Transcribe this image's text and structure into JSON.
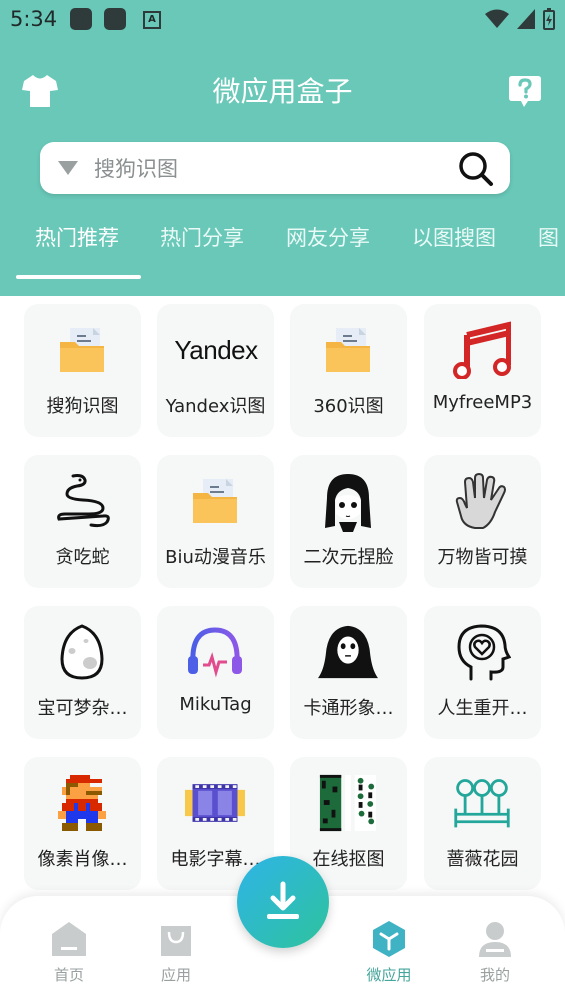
{
  "status_bar": {
    "time": "5:34",
    "a_icon": "A"
  },
  "header": {
    "title": "微应用盒子",
    "accent_color": "#69c8b8"
  },
  "search": {
    "placeholder": "搜狗识图"
  },
  "tabs": [
    {
      "label": "热门推荐",
      "active": true
    },
    {
      "label": "热门分享",
      "active": false
    },
    {
      "label": "网友分享",
      "active": false
    },
    {
      "label": "以图搜图",
      "active": false
    },
    {
      "label": "图",
      "active": false
    }
  ],
  "apps": [
    {
      "label": "搜狗识图",
      "icon": "folder-icon"
    },
    {
      "label": "Yandex识图",
      "icon": "yandex-logo",
      "logo_text": "Yandex"
    },
    {
      "label": "360识图",
      "icon": "folder-icon"
    },
    {
      "label": "MyfreeMP3",
      "icon": "music-note-icon"
    },
    {
      "label": "贪吃蛇",
      "icon": "snake-icon"
    },
    {
      "label": "Biu动漫音乐",
      "icon": "folder-icon"
    },
    {
      "label": "二次元捏脸",
      "icon": "anime-face-icon"
    },
    {
      "label": "万物皆可摸",
      "icon": "hand-icon"
    },
    {
      "label": "宝可梦杂…",
      "icon": "egg-icon"
    },
    {
      "label": "MikuTag",
      "icon": "headphones-icon"
    },
    {
      "label": "卡通形象…",
      "icon": "ghost-icon"
    },
    {
      "label": "人生重开…",
      "icon": "head-heart-icon"
    },
    {
      "label": "像素肖像…",
      "icon": "pixel-mario-icon"
    },
    {
      "label": "电影字幕…",
      "icon": "film-icon"
    },
    {
      "label": "在线抠图",
      "icon": "cutout-icon"
    },
    {
      "label": "蔷薇花园",
      "icon": "garden-icon"
    }
  ],
  "bottom_nav": [
    {
      "label": "首页",
      "icon": "home-icon",
      "active": false
    },
    {
      "label": "应用",
      "icon": "bag-icon",
      "active": false
    },
    {
      "label": "微应用",
      "icon": "cube-icon",
      "active": true
    },
    {
      "label": "我的",
      "icon": "user-icon",
      "active": false
    }
  ],
  "fab": {
    "icon": "download-icon"
  }
}
